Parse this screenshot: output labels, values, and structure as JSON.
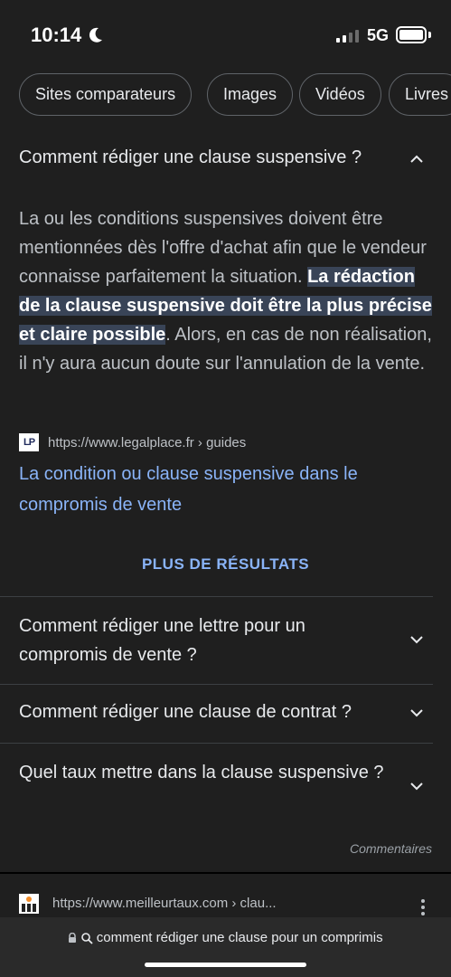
{
  "status_bar": {
    "time": "10:14",
    "network": "5G",
    "battery_level": 1.0
  },
  "chips": [
    {
      "label": "Sites comparateurs"
    },
    {
      "label": "Images"
    },
    {
      "label": "Vidéos"
    },
    {
      "label": "Livres"
    }
  ],
  "expanded_question": {
    "question": "Comment rédiger une clause suspensive ?",
    "answer_before": "La ou les conditions suspensives doivent être mentionnées dès l'offre d'achat afin que le vendeur connaisse parfaitement la situation. ",
    "answer_highlight": "La rédaction de la clause suspensive doit être la plus précise et claire possible",
    "answer_after": ". Alors, en cas de non réalisation, il n'y aura aucun doute sur l'annulation de la vente.",
    "source_favicon_text": "LP",
    "source_url": "https://www.legalplace.fr › guides",
    "link_title": "La condition ou clause suspensive dans le compromis de vente"
  },
  "more_results_label": "PLUS DE RÉSULTATS",
  "questions": [
    {
      "text": "Comment rédiger une lettre pour un compromis de vente ?"
    },
    {
      "text": "Comment rédiger une clause de contrat ?"
    },
    {
      "text": "Quel taux mettre dans la clause suspensive ?"
    }
  ],
  "feedback_label": "Commentaires",
  "next_result": {
    "url": "https://www.meilleurtaux.com › clau..."
  },
  "url_bar": {
    "query": "comment rédiger une clause pour un comprimis"
  },
  "colors": {
    "background": "#1f1f1f",
    "link": "#8ab4f8",
    "highlight": "#394457",
    "text": "#e8eaed"
  }
}
